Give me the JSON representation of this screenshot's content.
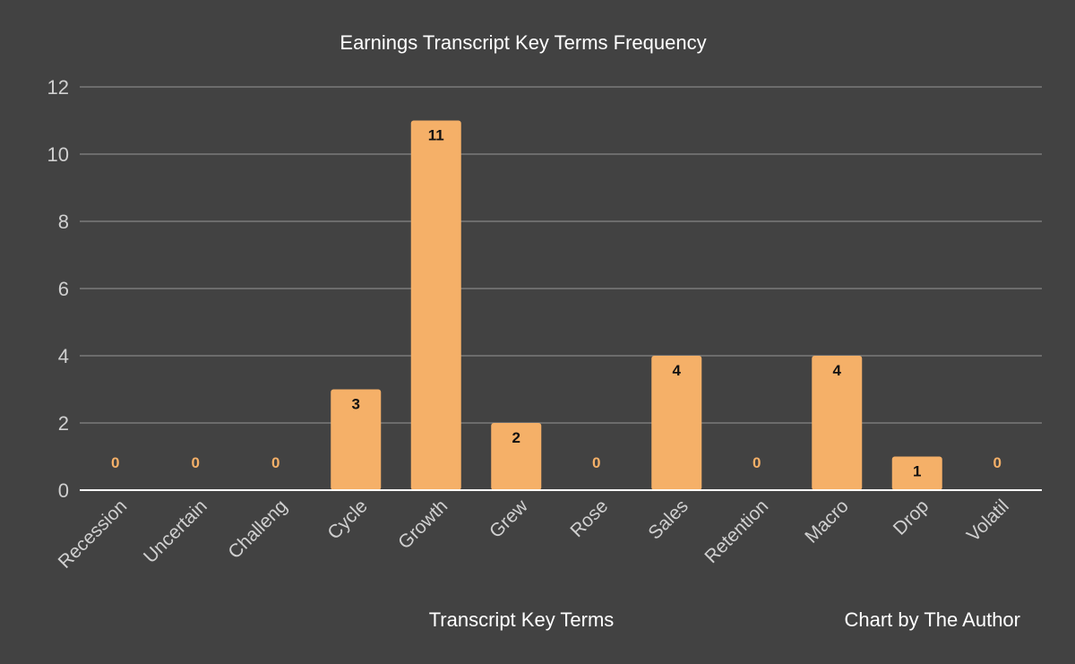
{
  "chart_data": {
    "type": "bar",
    "title": "Earnings Transcript Key Terms Frequency",
    "xlabel": "Transcript Key Terms",
    "ylabel": "",
    "credit": "Chart by The Author",
    "categories": [
      "Recession",
      "Uncertain",
      "Challeng",
      "Cycle",
      "Growth",
      "Grew",
      "Rose",
      "Sales",
      "Retention",
      "Macro",
      "Drop",
      "Volatil"
    ],
    "values": [
      0,
      0,
      0,
      3,
      11,
      2,
      0,
      4,
      0,
      4,
      1,
      0
    ],
    "ylim": [
      0,
      12
    ],
    "yticks": [
      0,
      2,
      4,
      6,
      8,
      10,
      12
    ],
    "grid": true,
    "legend": "none",
    "colors": {
      "background": "#424242",
      "bar": "#f5b068",
      "grid": "#7a7a7a",
      "text": "#d0d0d0"
    }
  }
}
